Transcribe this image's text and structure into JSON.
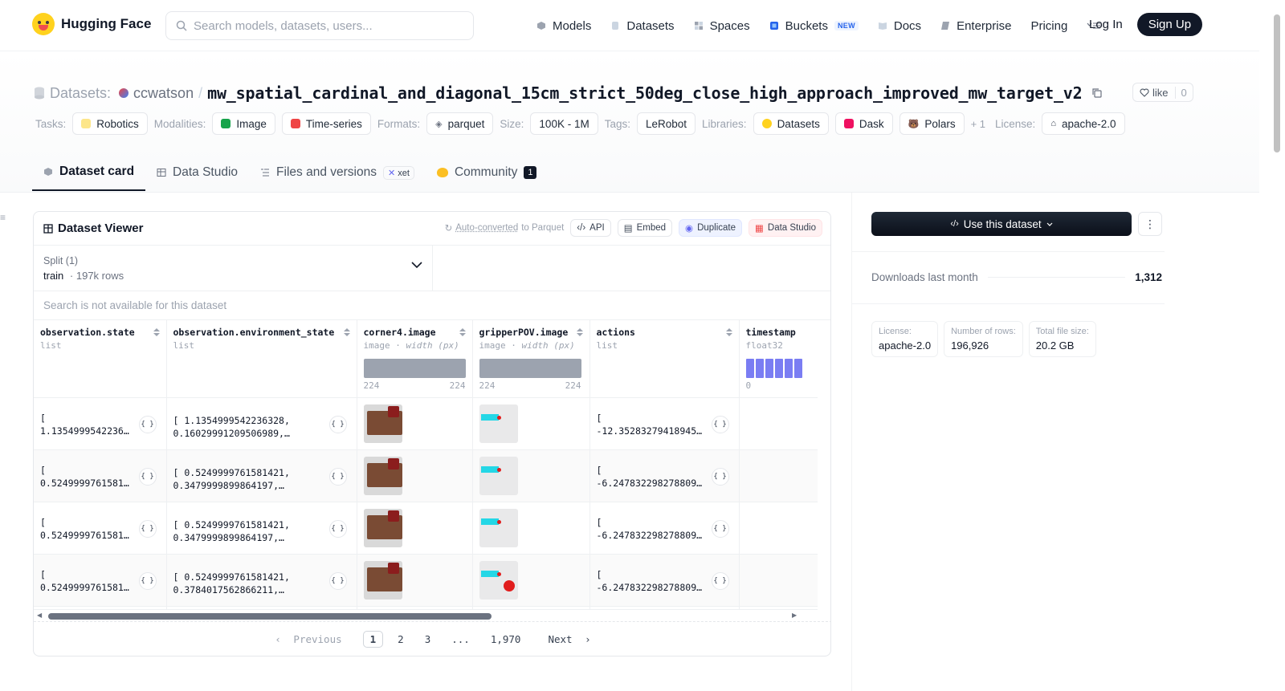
{
  "nav": {
    "logo_text": "Hugging Face",
    "search_placeholder": "Search models, datasets, users...",
    "links": [
      {
        "label": "Models",
        "icon": "cube-icon"
      },
      {
        "label": "Datasets",
        "icon": "database-icon"
      },
      {
        "label": "Spaces",
        "icon": "grid-icon"
      },
      {
        "label": "Buckets",
        "icon": "bucket-icon",
        "badge": "NEW"
      },
      {
        "label": "Docs",
        "icon": "book-icon"
      },
      {
        "label": "Enterprise",
        "icon": "enterprise-icon"
      },
      {
        "label": "Pricing"
      }
    ],
    "login": "Log In",
    "signup": "Sign Up"
  },
  "header": {
    "prefix": "Datasets:",
    "owner": "ccwatson",
    "separator": "/",
    "name": "mw_spatial_cardinal_and_diagonal_15cm_strict_50deg_close_high_approach_improved_mw_target_v2",
    "like_label": "like",
    "like_count": "0"
  },
  "tags": {
    "tasks_label": "Tasks:",
    "tasks": [
      "Robotics"
    ],
    "modalities_label": "Modalities:",
    "modalities": [
      "Image",
      "Time-series"
    ],
    "formats_label": "Formats:",
    "formats": [
      "parquet"
    ],
    "size_label": "Size:",
    "size": "100K - 1M",
    "tags_label": "Tags:",
    "tags": [
      "LeRobot"
    ],
    "libraries_label": "Libraries:",
    "libraries": [
      "Datasets",
      "Dask",
      "Polars"
    ],
    "libraries_more": "+ 1",
    "license_label": "License:",
    "license": "apache-2.0"
  },
  "tabs": [
    {
      "label": "Dataset card",
      "active": true
    },
    {
      "label": "Data Studio"
    },
    {
      "label": "Files and versions",
      "badge": "xet"
    },
    {
      "label": "Community",
      "count": "1"
    }
  ],
  "viewer": {
    "title": "Dataset Viewer",
    "auto_converted_link": "Auto-converted",
    "auto_converted_rest": "to Parquet",
    "buttons": [
      "API",
      "Embed",
      "Duplicate",
      "Data Studio"
    ],
    "split_label": "Split (1)",
    "split_value": "train",
    "split_rows": "197k rows",
    "search_na": "Search is not available for this dataset",
    "columns": [
      {
        "name": "observation.state",
        "type": "list"
      },
      {
        "name": "observation.environment_state",
        "type": "list"
      },
      {
        "name": "corner4.image",
        "type": "image",
        "extra": "width (px)",
        "min": "224",
        "max": "224"
      },
      {
        "name": "gripperPOV.image",
        "type": "image",
        "extra": "width (px)",
        "min": "224",
        "max": "224"
      },
      {
        "name": "actions",
        "type": "list"
      },
      {
        "name": "timestamp",
        "type": "float32",
        "min": "0"
      }
    ],
    "rows": [
      {
        "state": "[\n1.1354999542236…",
        "env": "[ 1.1354999542236328,\n0.16029991209506989,…",
        "actions": "[\n-12.35283279418945…"
      },
      {
        "state": "[\n0.5249999761581…",
        "env": "[ 0.5249999761581421,\n0.3479999899864197,…",
        "actions": "[\n-6.247832298278809…"
      },
      {
        "state": "[\n0.5249999761581…",
        "env": "[ 0.5249999761581421,\n0.3479999899864197,…",
        "actions": "[\n-6.247832298278809…"
      },
      {
        "state": "[\n0.5249999761581…",
        "env": "[ 0.5249999761581421,\n0.3784017562866211,…",
        "actions": "[\n-6.247832298278809…"
      }
    ],
    "json_icon": "{ }",
    "pager": {
      "prev": "Previous",
      "pages": [
        "1",
        "2",
        "3",
        "...",
        "1,970"
      ],
      "next": "Next"
    }
  },
  "sidebar": {
    "use_button": "Use this dataset",
    "downloads_label": "Downloads last month",
    "downloads_value": "1,312",
    "stats": [
      {
        "label": "License:",
        "value": "apache-2.0"
      },
      {
        "label": "Number of rows:",
        "value": "196,926"
      },
      {
        "label": "Total file size:",
        "value": "20.2 GB"
      }
    ]
  }
}
